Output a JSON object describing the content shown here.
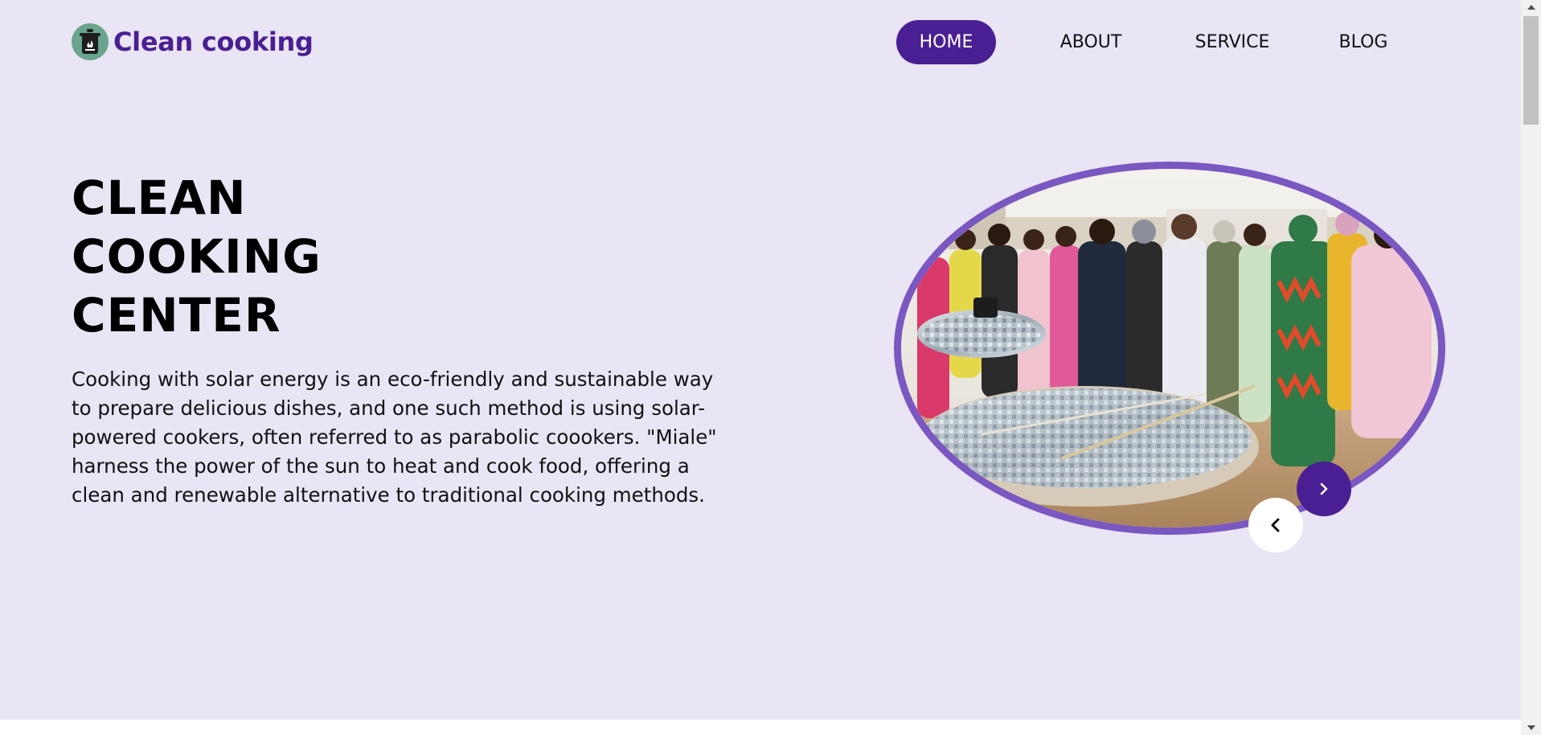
{
  "brand": {
    "name": "Clean cooking",
    "logo_icon": "cooking-pot-icon",
    "color": "#4a1f93"
  },
  "nav": {
    "items": [
      {
        "label": "HOME",
        "active": true
      },
      {
        "label": "ABOUT",
        "active": false
      },
      {
        "label": "SERVICE",
        "active": false
      },
      {
        "label": "BLOG",
        "active": false
      }
    ]
  },
  "hero": {
    "title_lines": [
      "CLEAN",
      "COOKING",
      "CENTER"
    ],
    "description": "Cooking with solar energy is an eco-friendly and sustainable way to prepare delicious dishes, and one such method is using solar-powered cookers, often referred to as parabolic coookers. \"Miale\" harness the power of the sun to heat and cook food, offering a clean and renewable alternative to traditional cooking methods."
  },
  "slider": {
    "image": "solar-cooker-demonstration-photo",
    "next_icon": "chevron-right-icon",
    "prev_icon": "chevron-left-icon"
  },
  "colors": {
    "background": "#e9e5f4",
    "accent": "#4a1f93",
    "frame": "#7a57c1"
  }
}
